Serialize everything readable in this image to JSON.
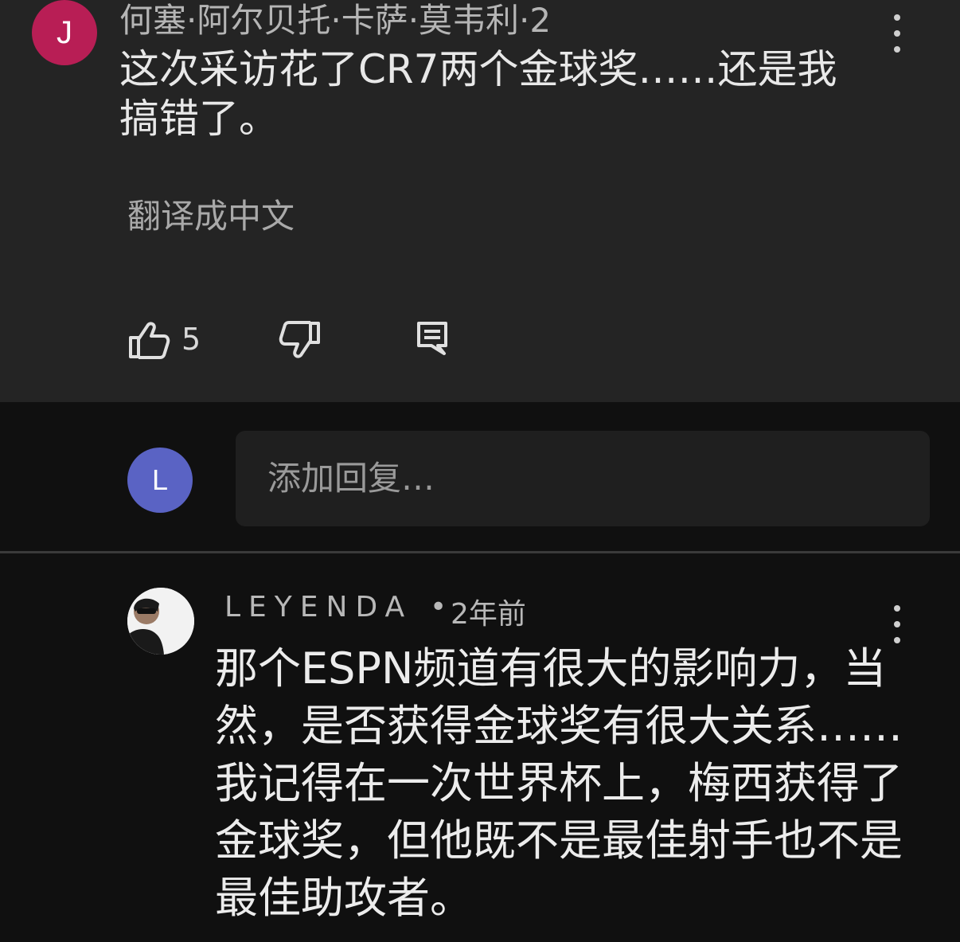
{
  "comment": {
    "avatar_letter": "J",
    "author_line": "何塞·阿尔贝托·卡萨·莫韦利·2",
    "text": "这次采访花了CR7两个金球奖……还是我搞错了。",
    "translate_label": "翻译成中文",
    "like_count": "5",
    "icons": [
      "thumbs-up-icon",
      "thumbs-down-icon",
      "reply-icon",
      "more-vert-icon"
    ]
  },
  "reply_box": {
    "avatar_letter": "L",
    "placeholder": "添加回复…"
  },
  "reply": {
    "author": "LEYENDA",
    "separator": "•",
    "time": "2年前",
    "text": "那个ESPN频道有很大的影响力，当然，是否获得金球奖有很大关系……我记得在一次世界杯上，梅西获得了金球奖，但他既不是最佳射手也不是最佳助攻者。"
  },
  "colors": {
    "avatar_j": "#b81e55",
    "avatar_l": "#5a63c4",
    "card_bg": "#242424",
    "page_bg": "#101010"
  }
}
